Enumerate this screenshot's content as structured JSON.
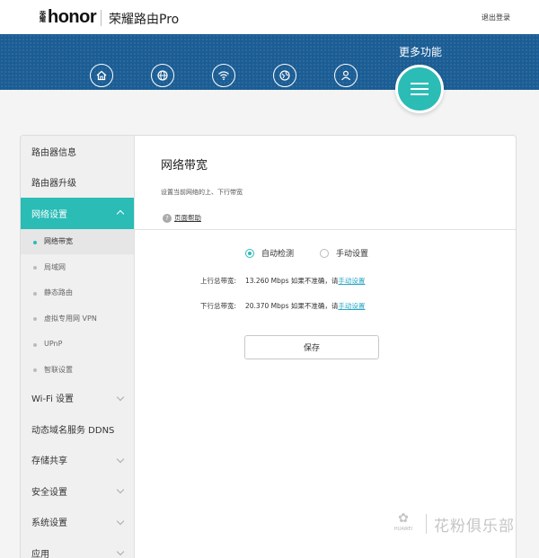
{
  "header": {
    "brand_small": "荣耀",
    "brand_logo": "honor",
    "product_name": "荣耀路由Pro",
    "logout": "退出登录"
  },
  "nav": {
    "icons": [
      "home-icon",
      "globe-icon",
      "wifi-icon",
      "network-globe-icon",
      "user-icon"
    ],
    "more_label": "更多功能",
    "more_icon": "menu-icon"
  },
  "sidebar": {
    "items": [
      {
        "label": "路由器信息"
      },
      {
        "label": "路由器升级"
      },
      {
        "label": "网络设置",
        "active": true
      }
    ],
    "sub_items": [
      {
        "label": "网络带宽",
        "selected": true
      },
      {
        "label": "局域网"
      },
      {
        "label": "静态路由"
      },
      {
        "label": "虚拟专用网 VPN"
      },
      {
        "label": "UPnP"
      },
      {
        "label": "智联设置"
      }
    ],
    "items_after": [
      {
        "label": "Wi-Fi 设置"
      },
      {
        "label": "动态域名服务 DDNS"
      },
      {
        "label": "存储共享"
      },
      {
        "label": "安全设置"
      },
      {
        "label": "系统设置"
      },
      {
        "label": "应用"
      }
    ]
  },
  "content": {
    "title": "网络带宽",
    "description": "设置当前网络的上、下行带宽",
    "help": "页面帮助",
    "radio_auto": "自动检测",
    "radio_manual": "手动设置",
    "upload_label": "上行总带宽:",
    "upload_value": "13.260 Mbps 如果不准确，请",
    "upload_link": "手动设置",
    "download_label": "下行总带宽:",
    "download_value": "20.370 Mbps 如果不准确，请",
    "download_link": "手动设置",
    "save": "保存"
  },
  "watermark": {
    "brand": "HUAWEI",
    "text": "花粉俱乐部"
  },
  "colors": {
    "accent": "#2bbcb6",
    "nav_blue": "#1b5d94",
    "link": "#2aa8c4"
  }
}
